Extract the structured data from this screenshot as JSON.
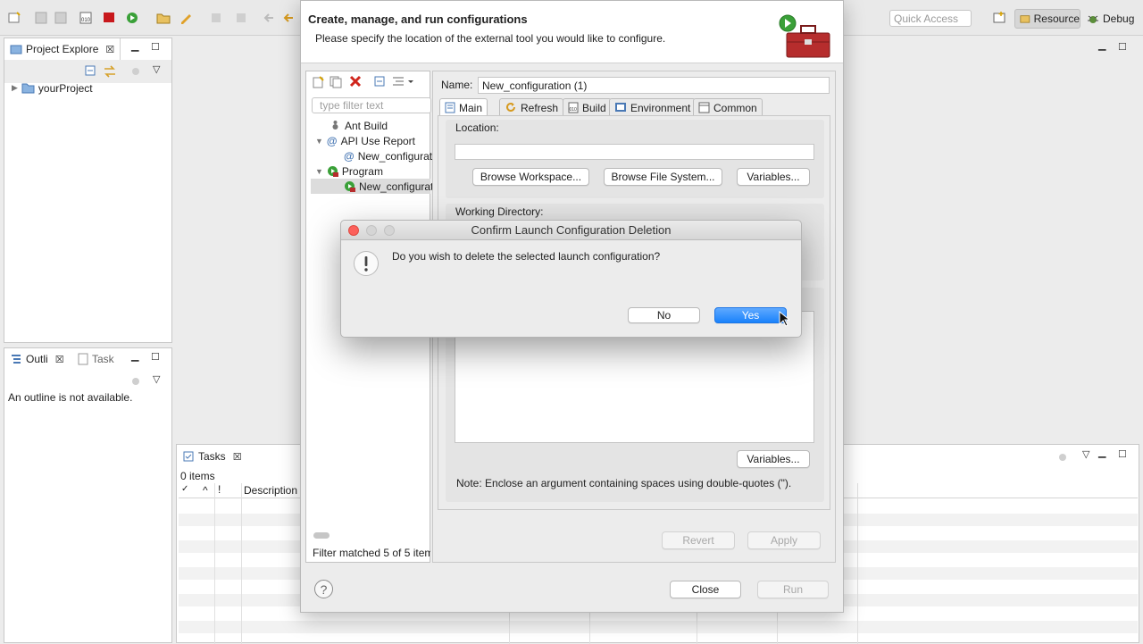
{
  "toolbar": {
    "quick_access_placeholder": "Quick Access",
    "perspective_resource": "Resource",
    "perspective_debug": "Debug"
  },
  "project_explorer": {
    "tab_label": "Project Explore",
    "project_name": "yourProject"
  },
  "outline": {
    "tab_label": "Outli",
    "task_tab_label": "Task",
    "message": "An outline is not available."
  },
  "tasks": {
    "tab_label": "Tasks",
    "count": "0 items",
    "col_check": "✓",
    "col_priority": "^",
    "col_important": "!",
    "col_description": "Description"
  },
  "ext_dialog": {
    "title": "Create, manage, and run configurations",
    "subtitle": "Please specify the location of the external tool you would like to configure.",
    "filter_placeholder": "type filter text",
    "tree": [
      {
        "label": "Ant Build"
      },
      {
        "label": "API Use Report"
      },
      {
        "label": "New_configurat"
      },
      {
        "label": "Program"
      },
      {
        "label": "New_configurat"
      }
    ],
    "filter_status": "Filter matched 5 of 5 item",
    "name_label": "Name:",
    "name_value": "New_configuration (1)",
    "tabs": [
      "Main",
      "Refresh",
      "Build",
      "Environment",
      "Common"
    ],
    "location_label": "Location:",
    "location_value": "",
    "browse_workspace": "Browse Workspace...",
    "browse_filesystem": "Browse File System...",
    "variables": "Variables...",
    "working_dir_label": "Working Directory:",
    "args_variables": "Variables...",
    "note": "Note: Enclose an argument containing spaces using double-quotes (\").",
    "revert": "Revert",
    "apply": "Apply",
    "close": "Close",
    "run": "Run",
    "help": "?"
  },
  "confirm_dialog": {
    "title": "Confirm Launch Configuration Deletion",
    "message": "Do you wish to delete the selected launch configuration?",
    "no": "No",
    "yes": "Yes"
  },
  "colors": {
    "accent": "#1a82fb",
    "selection": "#dcdcdc",
    "delete_red": "#d0261d",
    "mac_close": "#fc605b"
  }
}
